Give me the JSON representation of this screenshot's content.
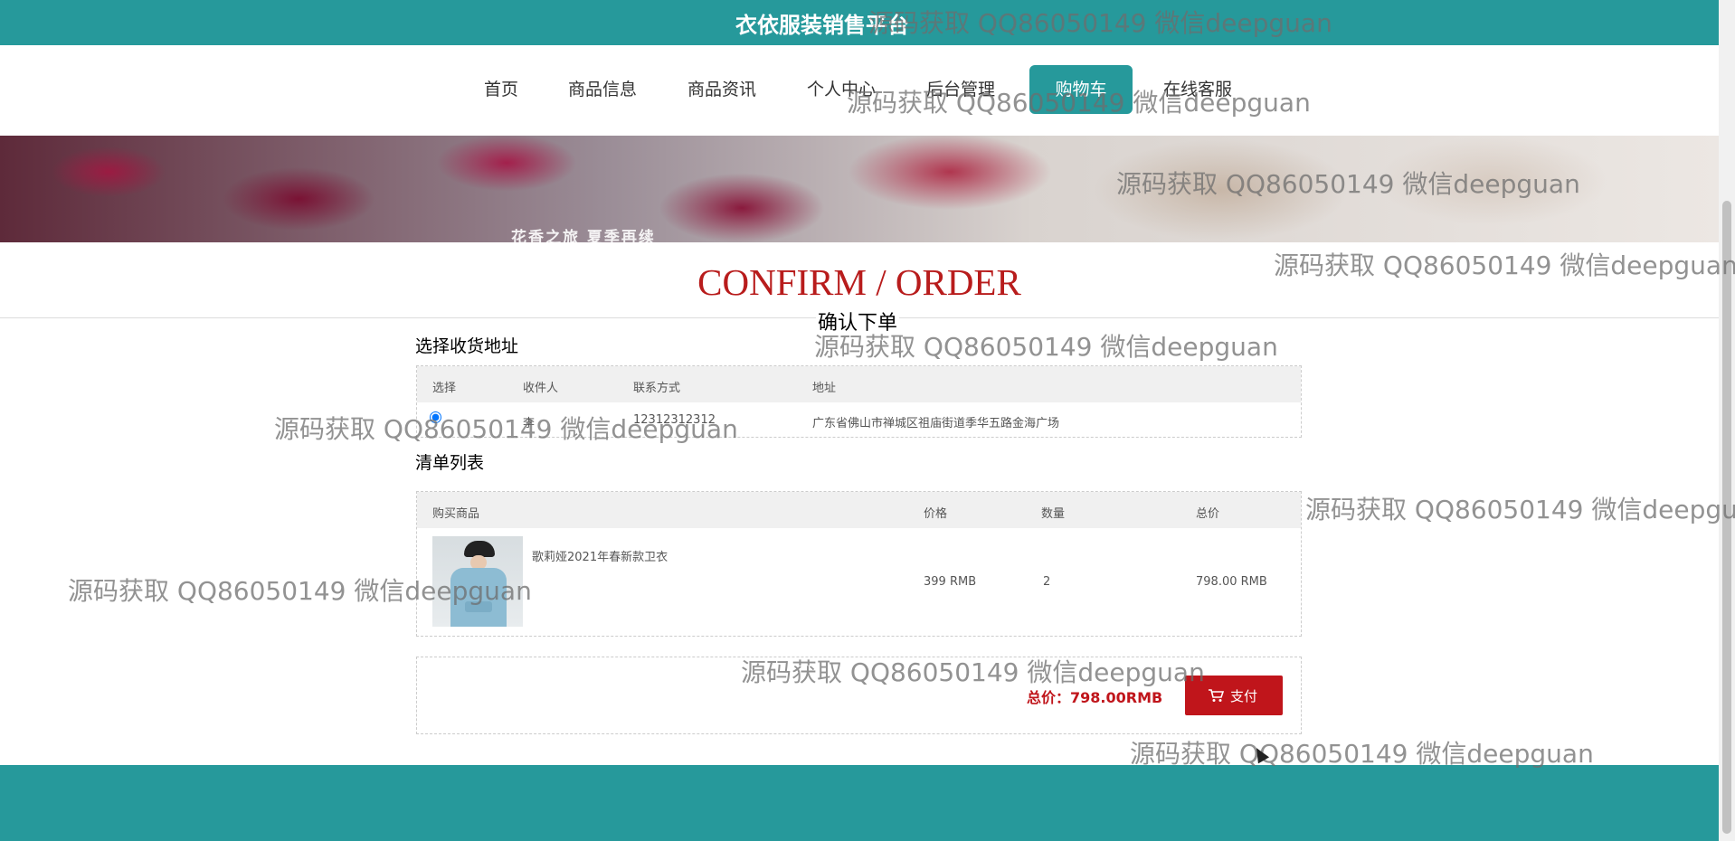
{
  "header": {
    "title": "衣依服装销售平台",
    "accent_color": "#26999b"
  },
  "nav": {
    "items": [
      {
        "label": "首页"
      },
      {
        "label": "商品信息"
      },
      {
        "label": "商品资讯"
      },
      {
        "label": "个人中心"
      },
      {
        "label": "后台管理"
      },
      {
        "label": "购物车",
        "active": true
      },
      {
        "label": "在线客服"
      }
    ]
  },
  "banner": {
    "caption": "花香之旅 夏季再续"
  },
  "page": {
    "heading": "CONFIRM / ORDER",
    "subheading": "确认下单"
  },
  "address_section": {
    "title": "选择收货地址",
    "columns": [
      "选择",
      "收件人",
      "联系方式",
      "地址"
    ],
    "rows": [
      {
        "selected": true,
        "recipient": "李",
        "phone": "12312312312",
        "address": "广东省佛山市禅城区祖庙街道季华五路金海广场"
      }
    ]
  },
  "list_section": {
    "title": "清单列表",
    "columns": [
      "购买商品",
      "价格",
      "数量",
      "总价"
    ],
    "items": [
      {
        "name": "歌莉娅2021年春新款卫衣",
        "price": "399 RMB",
        "quantity": "2",
        "total": "798.00 RMB"
      }
    ]
  },
  "summary": {
    "total_label": "总价：798.00RMB",
    "pay_label": "支付",
    "pay_color": "#c0151b"
  },
  "watermark": "源码获取 QQ86050149 微信deepguan"
}
